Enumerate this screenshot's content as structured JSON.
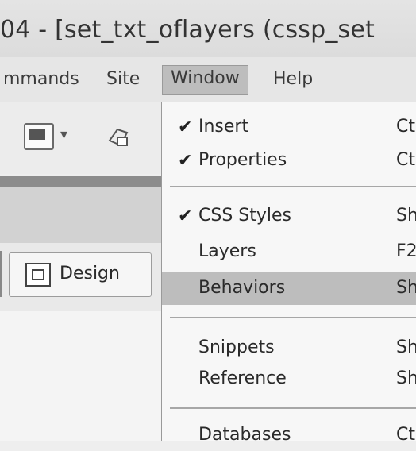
{
  "window": {
    "title": "04 - [set_txt_oflayers (cssp_set"
  },
  "menubar": {
    "items": [
      {
        "label": "mmands"
      },
      {
        "label": "Site"
      },
      {
        "label": "Window",
        "active": true
      },
      {
        "label": "Help"
      }
    ]
  },
  "toolbar": {
    "dropdown_glyph": "▾"
  },
  "view": {
    "design_label": "Design"
  },
  "window_menu": {
    "items": [
      {
        "check": "✔",
        "label": "Insert",
        "shortcut": "Ct"
      },
      {
        "check": "✔",
        "label": "Properties",
        "shortcut": "Ct"
      },
      {
        "check": "✔",
        "label": "CSS Styles",
        "shortcut": "Sh"
      },
      {
        "check": "",
        "label": "Layers",
        "shortcut": "F2"
      },
      {
        "check": "",
        "label": "Behaviors",
        "shortcut": "Sh",
        "highlighted": true
      },
      {
        "check": "",
        "label": "Snippets",
        "shortcut": "Sh"
      },
      {
        "check": "",
        "label": "Reference",
        "shortcut": "Sh"
      },
      {
        "check": "",
        "label": "Databases",
        "shortcut": "Ct"
      }
    ]
  },
  "colors": {
    "highlight": "#bdbdbd",
    "menu_bg": "#f7f7f7"
  }
}
